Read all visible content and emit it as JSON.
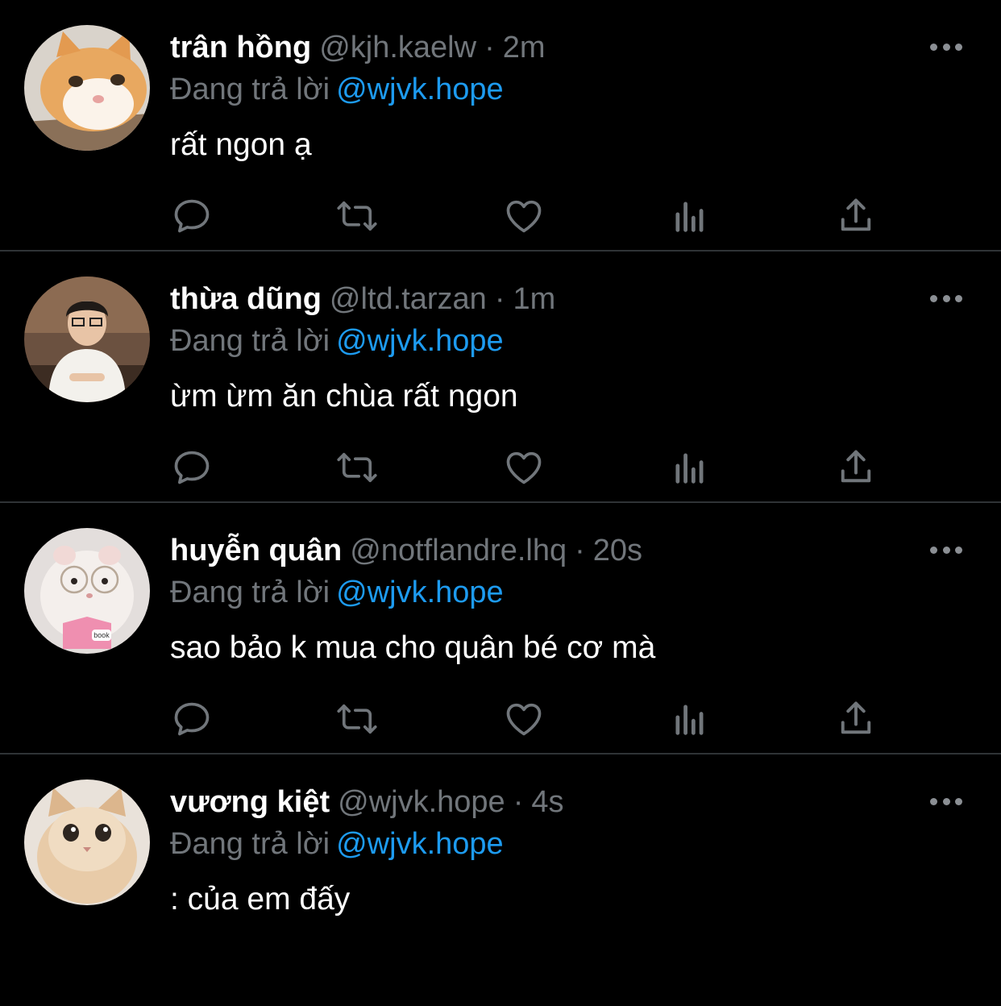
{
  "colors": {
    "background": "#000000",
    "primary_text": "#ffffff",
    "secondary_text": "#71767b",
    "link": "#1d9bf0",
    "divider": "#2f3336"
  },
  "reply_prefix": "Đang trả lời",
  "tweets": [
    {
      "name": "trân hồng",
      "handle": "@kjh.kaelw",
      "separator": "·",
      "time": "2m",
      "reply_to": "@wjvk.hope",
      "text": "rất ngon ạ",
      "avatar": "orange-cat-avatar"
    },
    {
      "name": "thừa dũng",
      "handle": "@ltd.tarzan",
      "separator": "·",
      "time": "1m",
      "reply_to": "@wjvk.hope",
      "text": "ừm ừm ăn chùa rất ngon",
      "avatar": "person-photo-avatar"
    },
    {
      "name": "huyễn quân",
      "handle": "@notflandre.lhq",
      "separator": "·",
      "time": "20s",
      "reply_to": "@wjvk.hope",
      "text": "sao bảo k mua cho quân bé cơ mà",
      "avatar": "hamster-with-glasses-avatar",
      "avatar_label": "book"
    },
    {
      "name": "vương kiệt",
      "handle": "@wjvk.hope",
      "separator": "·",
      "time": "4s",
      "reply_to": "@wjvk.hope",
      "text": ": của em đấy",
      "avatar": "cream-cat-avatar"
    }
  ],
  "action_icons": [
    "reply-icon",
    "retweet-icon",
    "like-icon",
    "views-icon",
    "share-icon"
  ]
}
